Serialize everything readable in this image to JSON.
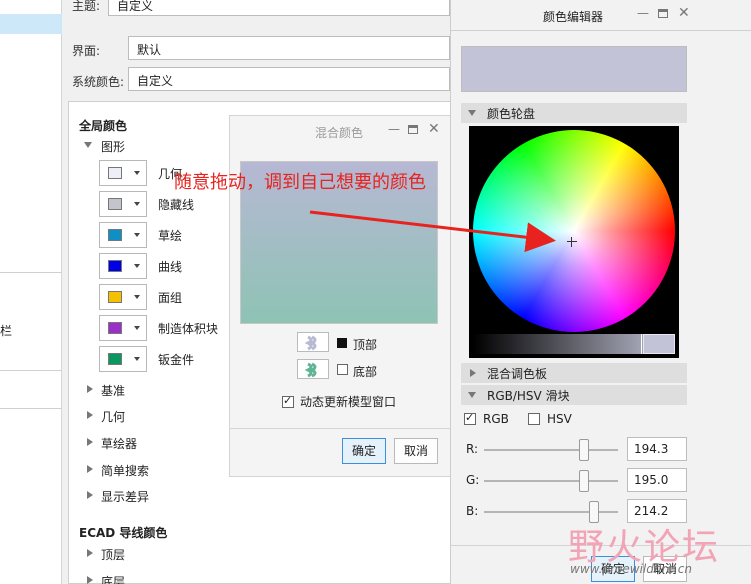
{
  "options": {
    "theme_label": "主题:",
    "theme_value": "自定义",
    "interface_label": "界面:",
    "interface_value": "默认",
    "system_color_label": "系统颜色:",
    "system_color_value": "自定义",
    "left_nav_partial": "栏"
  },
  "global_colors": {
    "title": "全局颜色",
    "graphics_group": "图形",
    "items": [
      {
        "label": "几何",
        "color": "#eeeef8"
      },
      {
        "label": "隐藏线",
        "color": "#c4c4cc"
      },
      {
        "label": "草绘",
        "color": "#0e8fc6"
      },
      {
        "label": "曲线",
        "color": "#0000e6"
      },
      {
        "label": "面组",
        "color": "#f5c000"
      },
      {
        "label": "制造体积块",
        "color": "#9b30c8"
      },
      {
        "label": "钣金件",
        "color": "#0b9860"
      }
    ],
    "collapsed": [
      "基准",
      "几何",
      "草绘器",
      "简单搜索",
      "显示差异"
    ],
    "ecad_title": "ECAD 导线颜色",
    "ecad_items": [
      "顶层",
      "底层"
    ],
    "right_partial": "几何"
  },
  "blend_dialog": {
    "title": "混合颜色",
    "top_label": "顶部",
    "bottom_label": "底部",
    "dynamic_update_label": "动态更新模型窗口",
    "dynamic_update_checked": true,
    "ok_label": "确定",
    "cancel_label": "取消",
    "gradient_top": "#b7b8d4",
    "gradient_bottom": "#8ec3b4"
  },
  "annotation": {
    "text": "随意拖动，调到自己想要的颜色",
    "color": "#e8221e"
  },
  "color_editor": {
    "title": "颜色编辑器",
    "preview_color": "#c2c3d6",
    "wheel_section": "颜色轮盘",
    "blend_palette_section": "混合调色板",
    "rgb_hsv_section": "RGB/HSV 滑块",
    "rgb_label": "RGB",
    "hsv_label": "HSV",
    "rgb_checked": true,
    "hsv_checked": false,
    "r_label": "R:",
    "g_label": "G:",
    "b_label": "B:",
    "r_value": "194.3",
    "g_value": "195.0",
    "b_value": "214.2",
    "ok_label": "确定",
    "cancel_label": "取消"
  },
  "watermark": {
    "text": "野火论坛",
    "url": "www.proewildfire.cn"
  }
}
